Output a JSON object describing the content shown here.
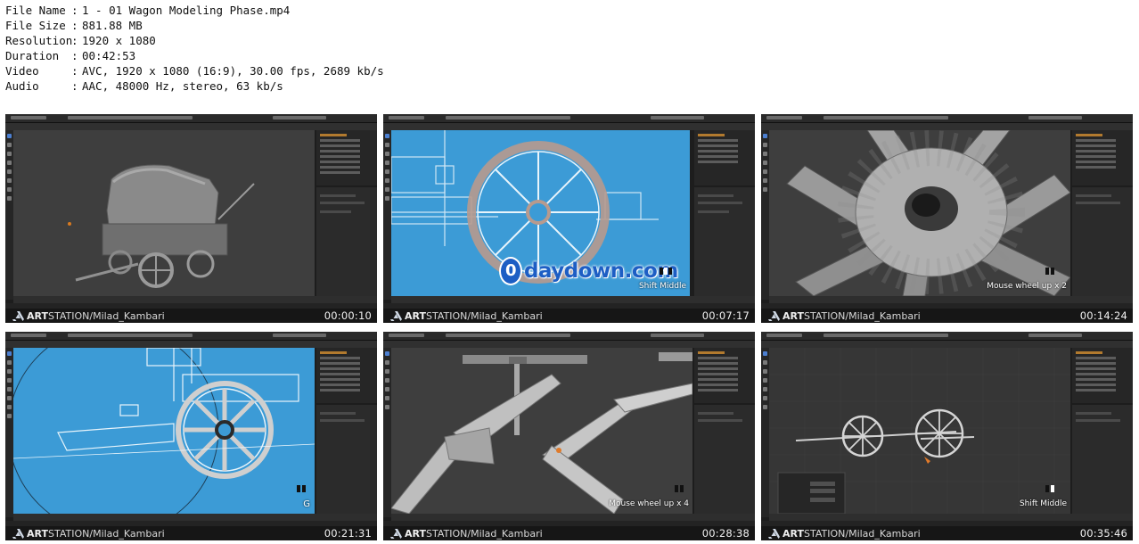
{
  "file_info": [
    {
      "key": "File Name",
      "value": "1 - 01 Wagon Modeling Phase.mp4"
    },
    {
      "key": "File Size",
      "value": "881.88 MB"
    },
    {
      "key": "Resolution",
      "value": "1920 x 1080"
    },
    {
      "key": "Duration",
      "value": "00:42:53"
    },
    {
      "key": "Video",
      "value": "AVC, 1920 x 1080 (16:9), 30.00 fps, 2689 kb/s"
    },
    {
      "key": "Audio",
      "value": "AAC, 48000 Hz, stereo, 63 kb/s"
    }
  ],
  "brand": {
    "strong": "ART",
    "rest": "STATION/Milad_Kambari"
  },
  "thumbnails": [
    {
      "timestamp": "00:00:10",
      "hint": "",
      "viewport": "grey"
    },
    {
      "timestamp": "00:07:17",
      "hint": "Shift Middle",
      "viewport": "blue",
      "watermark": "daydown.com",
      "watermark_zero": "0"
    },
    {
      "timestamp": "00:14:24",
      "hint": "Mouse wheel up x 2",
      "viewport": "grey"
    },
    {
      "timestamp": "00:21:31",
      "hint": "G",
      "viewport": "blue"
    },
    {
      "timestamp": "00:28:38",
      "hint": "Mouse wheel up x 4",
      "viewport": "grey"
    },
    {
      "timestamp": "00:35:46",
      "hint": "Shift Middle",
      "viewport": "dark"
    }
  ],
  "colors": {
    "viewport_blue": "#3c9bd6",
    "ui_dark": "#1d1d1d",
    "watermark": "#1d5ec4"
  }
}
